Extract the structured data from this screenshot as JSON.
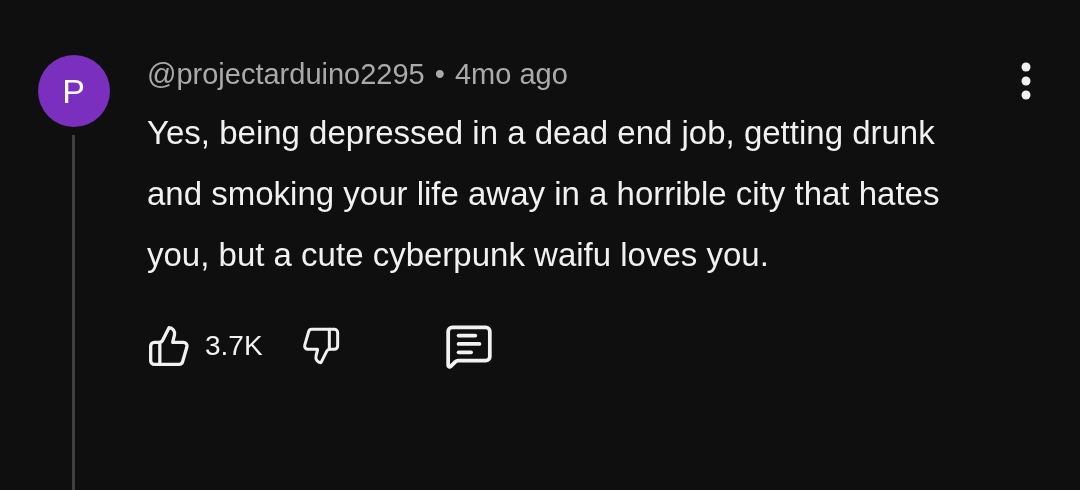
{
  "comment": {
    "avatar_letter": "P",
    "author": "@projectarduino2295",
    "separator": "•",
    "time": "4mo ago",
    "text": "Yes, being depressed in a dead end job, getting drunk and smoking your life away in a horrible city that hates you, but a cute cyberpunk waifu loves you.",
    "likes": "3.7K"
  }
}
